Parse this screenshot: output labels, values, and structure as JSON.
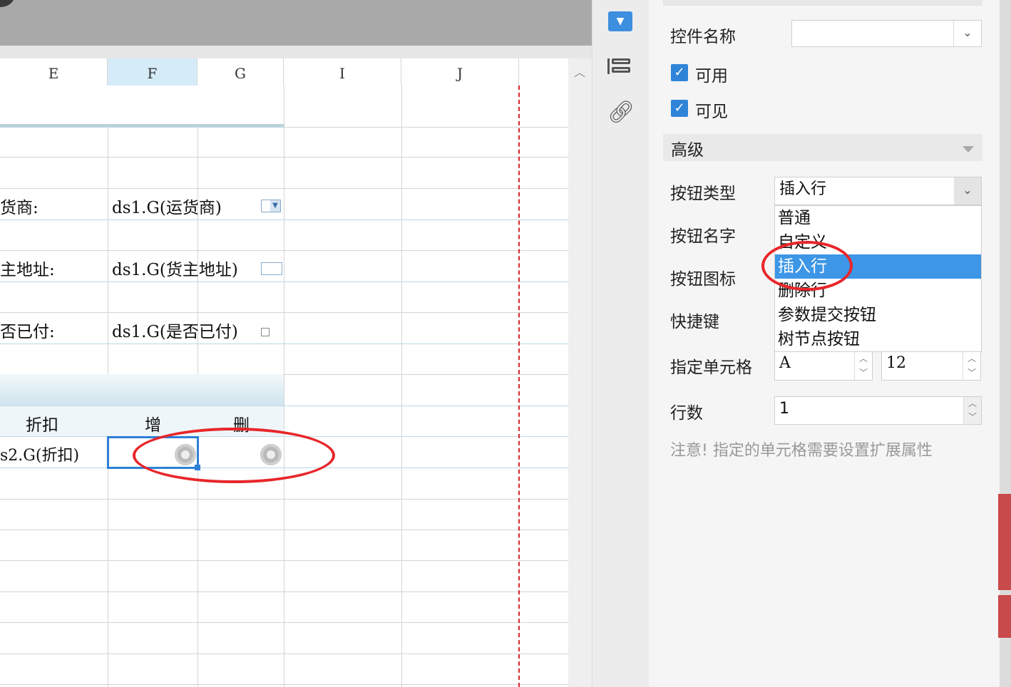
{
  "columns": [
    "E",
    "F",
    "G",
    "I",
    "J"
  ],
  "cells": {
    "row_shipper_label": "货商:",
    "row_shipper_value": "ds1.G(运货商)",
    "row_address_label": "主地址:",
    "row_address_value": "ds1.G(货主地址)",
    "row_paid_label": "否已付:",
    "row_paid_value": "ds1.G(是否已付)",
    "header_discount": "折扣",
    "header_add": "增",
    "header_delete": "删",
    "discount_value": "s2.G(折扣)"
  },
  "panel": {
    "widget_name_label": "控件名称",
    "widget_name_value": "",
    "enabled_label": "可用",
    "enabled": true,
    "visible_label": "可见",
    "visible": true,
    "advanced_label": "高级",
    "button_type_label": "按钮类型",
    "button_type_value": "插入行",
    "button_name_label": "按钮名字",
    "button_icon_label": "按钮图标",
    "shortcut_label": "快捷键",
    "target_cell_label": "指定单元格",
    "target_cell_col": "A",
    "target_cell_row": "12",
    "row_count_label": "行数",
    "row_count_value": "1",
    "note": "注意! 指定的单元格需要设置扩展属性"
  },
  "dropdown": {
    "options": [
      "普通",
      "自定义",
      "插入行",
      "删除行",
      "参数提交按钮",
      "树节点按钮"
    ],
    "selected_index": 2
  },
  "colors": {
    "accent": "#3d96e6",
    "annotation": "#e8262a",
    "selected_column": "#d5ecf8"
  }
}
